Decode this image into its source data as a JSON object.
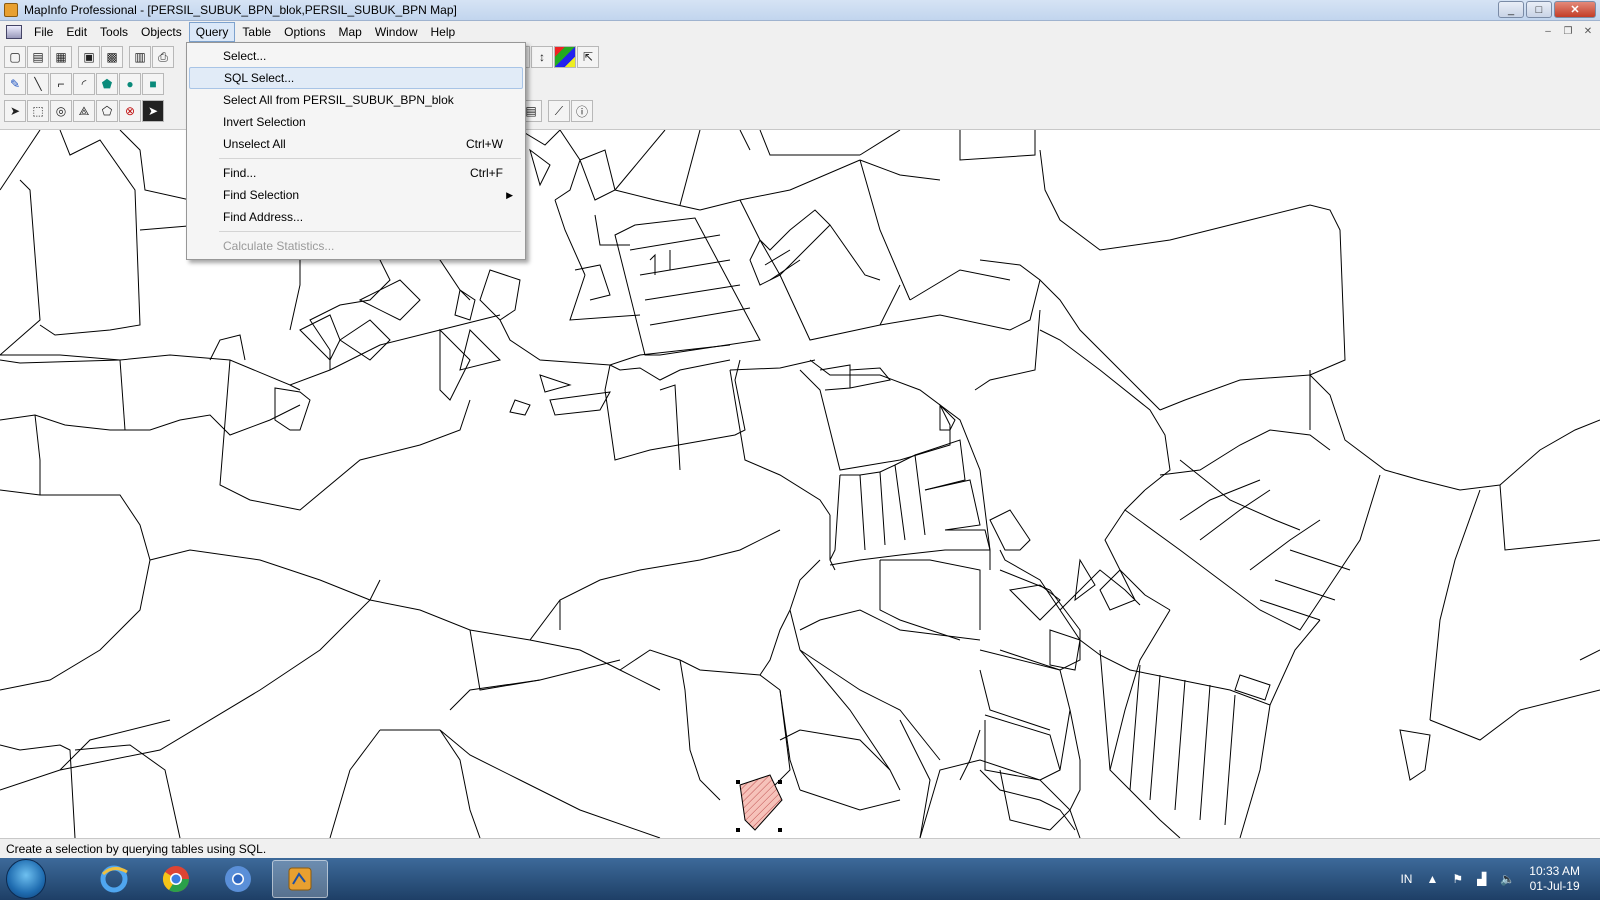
{
  "window": {
    "title": "MapInfo Professional - [PERSIL_SUBUK_BPN_blok,PERSIL_SUBUK_BPN Map]",
    "controls": [
      "minimize",
      "maximize",
      "close"
    ]
  },
  "menubar": {
    "items": [
      {
        "label": "File"
      },
      {
        "label": "Edit"
      },
      {
        "label": "Tools"
      },
      {
        "label": "Objects"
      },
      {
        "label": "Query",
        "active": true
      },
      {
        "label": "Table"
      },
      {
        "label": "Options"
      },
      {
        "label": "Map"
      },
      {
        "label": "Window"
      },
      {
        "label": "Help"
      }
    ]
  },
  "query_menu": {
    "items": [
      {
        "label": "Select...",
        "shortcut": ""
      },
      {
        "label": "SQL Select...",
        "shortcut": "",
        "highlighted": true
      },
      {
        "label": "Select All from PERSIL_SUBUK_BPN_blok",
        "shortcut": ""
      },
      {
        "label": "Invert Selection",
        "shortcut": ""
      },
      {
        "label": "Unselect All",
        "shortcut": "Ctrl+W"
      },
      {
        "label": "Find...",
        "shortcut": "Ctrl+F"
      },
      {
        "label": "Find Selection",
        "shortcut": "",
        "submenu": true
      },
      {
        "label": "Find Address...",
        "shortcut": ""
      },
      {
        "label": "Calculate Statistics...",
        "shortcut": "",
        "disabled": true
      }
    ]
  },
  "statusbar": {
    "text": "Create a selection by querying tables using SQL."
  },
  "taskbar": {
    "apps": [
      "windows-start",
      "internet-explorer",
      "chrome",
      "chrome-alt",
      "mapinfo"
    ],
    "language": "IN",
    "time": "10:33 AM",
    "date": "01-Jul-19"
  },
  "colors": {
    "selection_fill": "#f4b8b0",
    "menu_highlight": "#e1ebf7",
    "taskbar": "#1e3f66"
  }
}
